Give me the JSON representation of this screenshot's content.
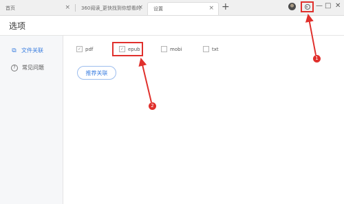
{
  "tabs": [
    {
      "label": "首页",
      "close": "×"
    },
    {
      "label": "360阅读_更快找到你想看的",
      "close": "×"
    },
    {
      "label": "设置",
      "close": "×"
    }
  ],
  "new_tab": "+",
  "window_controls": {
    "minimize": "—",
    "maximize": "□",
    "close": "✕"
  },
  "page": {
    "title": "选项"
  },
  "sidebar": {
    "items": [
      {
        "label": "文件关联",
        "icon": "⧉"
      },
      {
        "label": "常见问题",
        "icon": "?"
      }
    ]
  },
  "file_types": [
    {
      "label": "pdf",
      "checked": true,
      "mark": "✓"
    },
    {
      "label": "epub",
      "checked": true,
      "mark": "✓"
    },
    {
      "label": "mobi",
      "checked": false,
      "mark": ""
    },
    {
      "label": "txt",
      "checked": false,
      "mark": ""
    }
  ],
  "recommend_button": "推荐关联",
  "annotations": {
    "marker_1": "1",
    "marker_2": "2",
    "color": "#e0302c"
  },
  "colors": {
    "accent": "#3a7ee0",
    "highlight": "#e0302c"
  }
}
